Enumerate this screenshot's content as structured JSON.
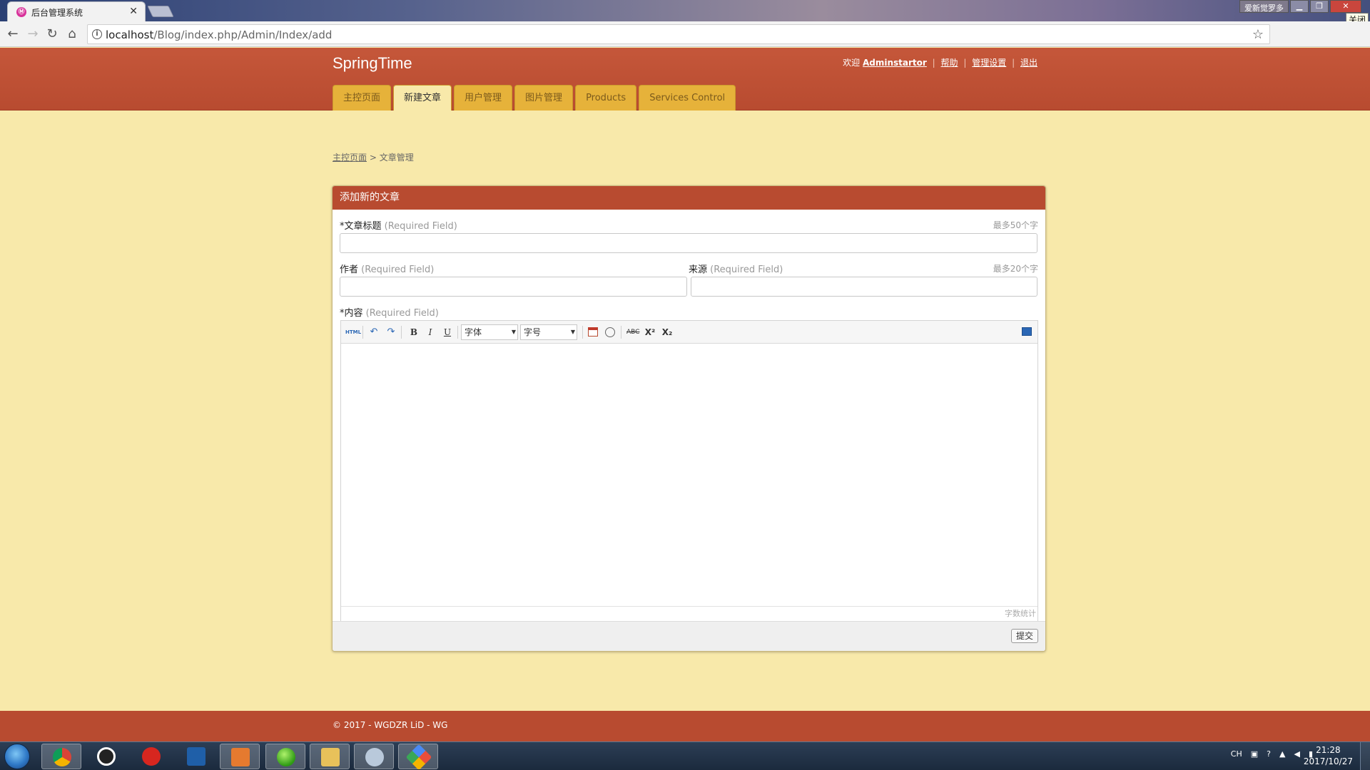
{
  "browser": {
    "tab_title": "后台管理系统",
    "tab_favicon": "Ⓜ",
    "tab_close": "✕",
    "url_host": "localhost",
    "url_path": "/Blog/index.php/Admin/Index/add",
    "window_label": "爱新觉罗多",
    "close_tooltip": "关闭"
  },
  "header": {
    "brand": "SpringTime",
    "welcome": "欢迎",
    "username": "Adminstartor",
    "links": [
      "帮助",
      "管理设置",
      "退出"
    ],
    "separator": "|"
  },
  "nav": {
    "tabs": [
      "主控页面",
      "新建文章",
      "用户管理",
      "图片管理",
      "Products",
      "Services Control"
    ],
    "active_index": 1
  },
  "breadcrumb": {
    "home": "主控页面",
    "separator": ">",
    "current": "文章管理"
  },
  "form": {
    "panel_title": "添加新的文章",
    "title_label": "*文章标题",
    "title_req": "(Required Field)",
    "title_hint": "最多50个字",
    "title_value": "",
    "author_label": "作者",
    "author_req": "(Required Field)",
    "author_value": "",
    "source_label": "来源",
    "source_req": "(Required Field)",
    "source_hint": "最多20个字",
    "source_value": "",
    "content_label": "*内容",
    "content_req": "(Required Field)",
    "submit_label": "提交"
  },
  "editor": {
    "html_btn": "HTML",
    "undo": "↶",
    "redo": "↷",
    "bold": "B",
    "italic": "I",
    "underline": "U",
    "font_family": "字体",
    "font_size": "字号",
    "strike": "ABC",
    "superscript": "X²",
    "subscript": "X₂",
    "word_count_label": "字数统计",
    "dropdown_arrow": "▼"
  },
  "footer": {
    "copyright": "© 2017 - WGDZR LiD - WG"
  },
  "taskbar": {
    "tray_lang": "CH",
    "time": "21:28",
    "date": "2017/10/27"
  }
}
